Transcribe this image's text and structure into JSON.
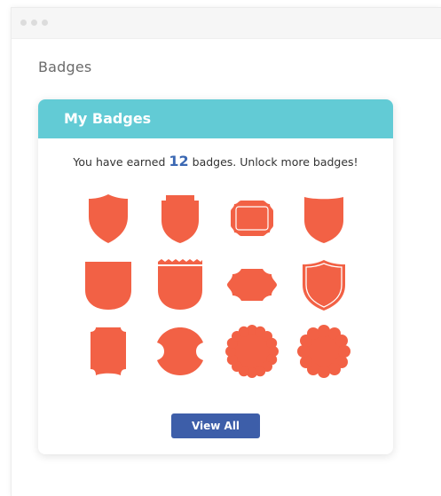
{
  "page": {
    "title": "Badges"
  },
  "card": {
    "header": "My Badges",
    "earned_prefix": "You have earned",
    "earned_count": "12",
    "earned_suffix": "badges. Unlock more badges!",
    "view_all_label": "View All"
  },
  "colors": {
    "header": "#62cbd5",
    "badge": "#f26145",
    "button": "#3d5ea9",
    "count": "#3b68b3"
  },
  "badges": [
    "shield-pointed-icon",
    "shield-notched-icon",
    "plaque-ornate-icon",
    "shield-curved-icon",
    "banner-round-icon",
    "banner-fringed-icon",
    "plaque-scalloped-icon",
    "shield-outlined-icon",
    "shield-bracket-icon",
    "circle-notched-icon",
    "seal-scalloped-icon",
    "seal-wavy-icon"
  ]
}
